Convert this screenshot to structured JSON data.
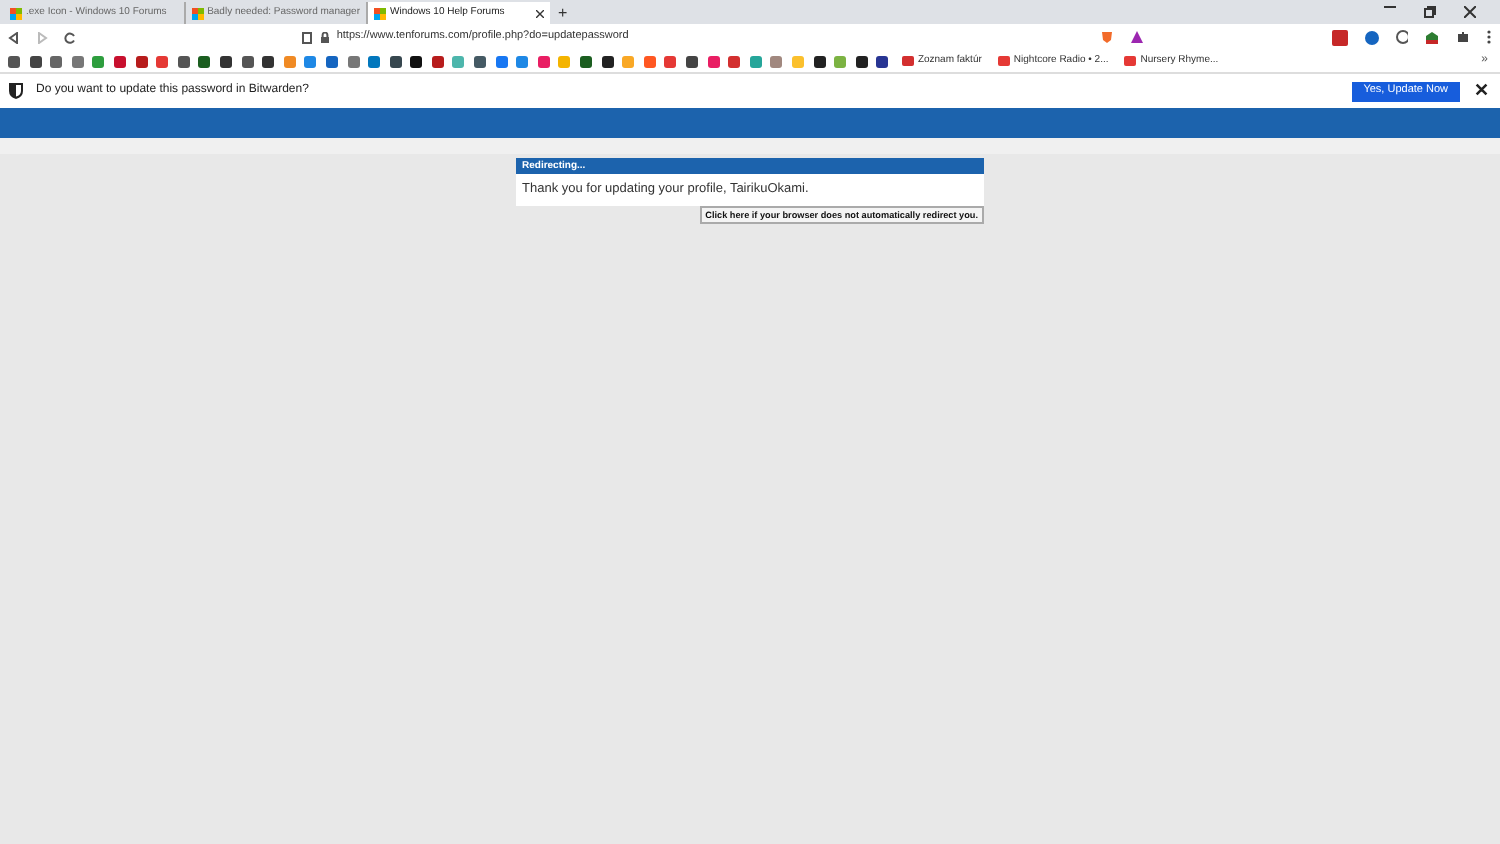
{
  "tabs": [
    {
      "label": ".exe Icon - Windows 10 Forums",
      "selected": false
    },
    {
      "label": "Badly needed: Password manager",
      "selected": false
    },
    {
      "label": "Windows 10 Help Forums",
      "selected": true
    }
  ],
  "new_tab": "+",
  "more_bookmarks": "»",
  "address_bar": {
    "url": "https://www.tenforums.com/profile.php?do=updatepassword"
  },
  "bookmarks": [
    {
      "color": "#555555"
    },
    {
      "color": "#444444"
    },
    {
      "color": "#666666"
    },
    {
      "color": "#777777"
    },
    {
      "color": "#2e9e3e"
    },
    {
      "color": "#c8102e"
    },
    {
      "color": "#b71c1c"
    },
    {
      "color": "#e53935"
    },
    {
      "color": "#555555"
    },
    {
      "color": "#1b5e20"
    },
    {
      "color": "#333333"
    },
    {
      "color": "#555555"
    },
    {
      "color": "#333333"
    },
    {
      "color": "#f08a24"
    },
    {
      "color": "#1e88e5"
    },
    {
      "color": "#1565c0"
    },
    {
      "color": "#777777"
    },
    {
      "color": "#0277bd"
    },
    {
      "color": "#37474f"
    },
    {
      "color": "#111111"
    },
    {
      "color": "#b71c1c"
    },
    {
      "color": "#4db6ac"
    },
    {
      "color": "#455a64"
    },
    {
      "color": "#1877f2"
    },
    {
      "color": "#1e88e5"
    },
    {
      "color": "#e91e63"
    },
    {
      "color": "#f4b400"
    },
    {
      "color": "#1b5e20"
    },
    {
      "color": "#222222"
    },
    {
      "color": "#f9a825"
    },
    {
      "color": "#ff5722"
    },
    {
      "color": "#e53935"
    },
    {
      "color": "#444444"
    },
    {
      "color": "#e91e63"
    },
    {
      "color": "#d32f2f"
    },
    {
      "color": "#26a69a"
    },
    {
      "color": "#a1887f"
    },
    {
      "color": "#fbc02d"
    },
    {
      "color": "#222222"
    },
    {
      "color": "#7cb342"
    },
    {
      "color": "#212121"
    },
    {
      "color": "#283593"
    }
  ],
  "named_bookmarks": [
    {
      "label": "Zoznam faktúr",
      "color": "#d32f2f"
    },
    {
      "label": "Nightcore Radio • 2...",
      "color": "#e53935"
    },
    {
      "label": "Nursery Rhyme...",
      "color": "#e53935"
    }
  ],
  "bitwarden_bar": {
    "message": "Do you want to update this password in Bitwarden?",
    "button": "Yes, Update Now",
    "close": "✕"
  },
  "dialog": {
    "title": "Redirecting...",
    "message": "Thank you for updating your profile, TairikuOkami.",
    "link": "Click here if your browser does not automatically redirect you."
  }
}
